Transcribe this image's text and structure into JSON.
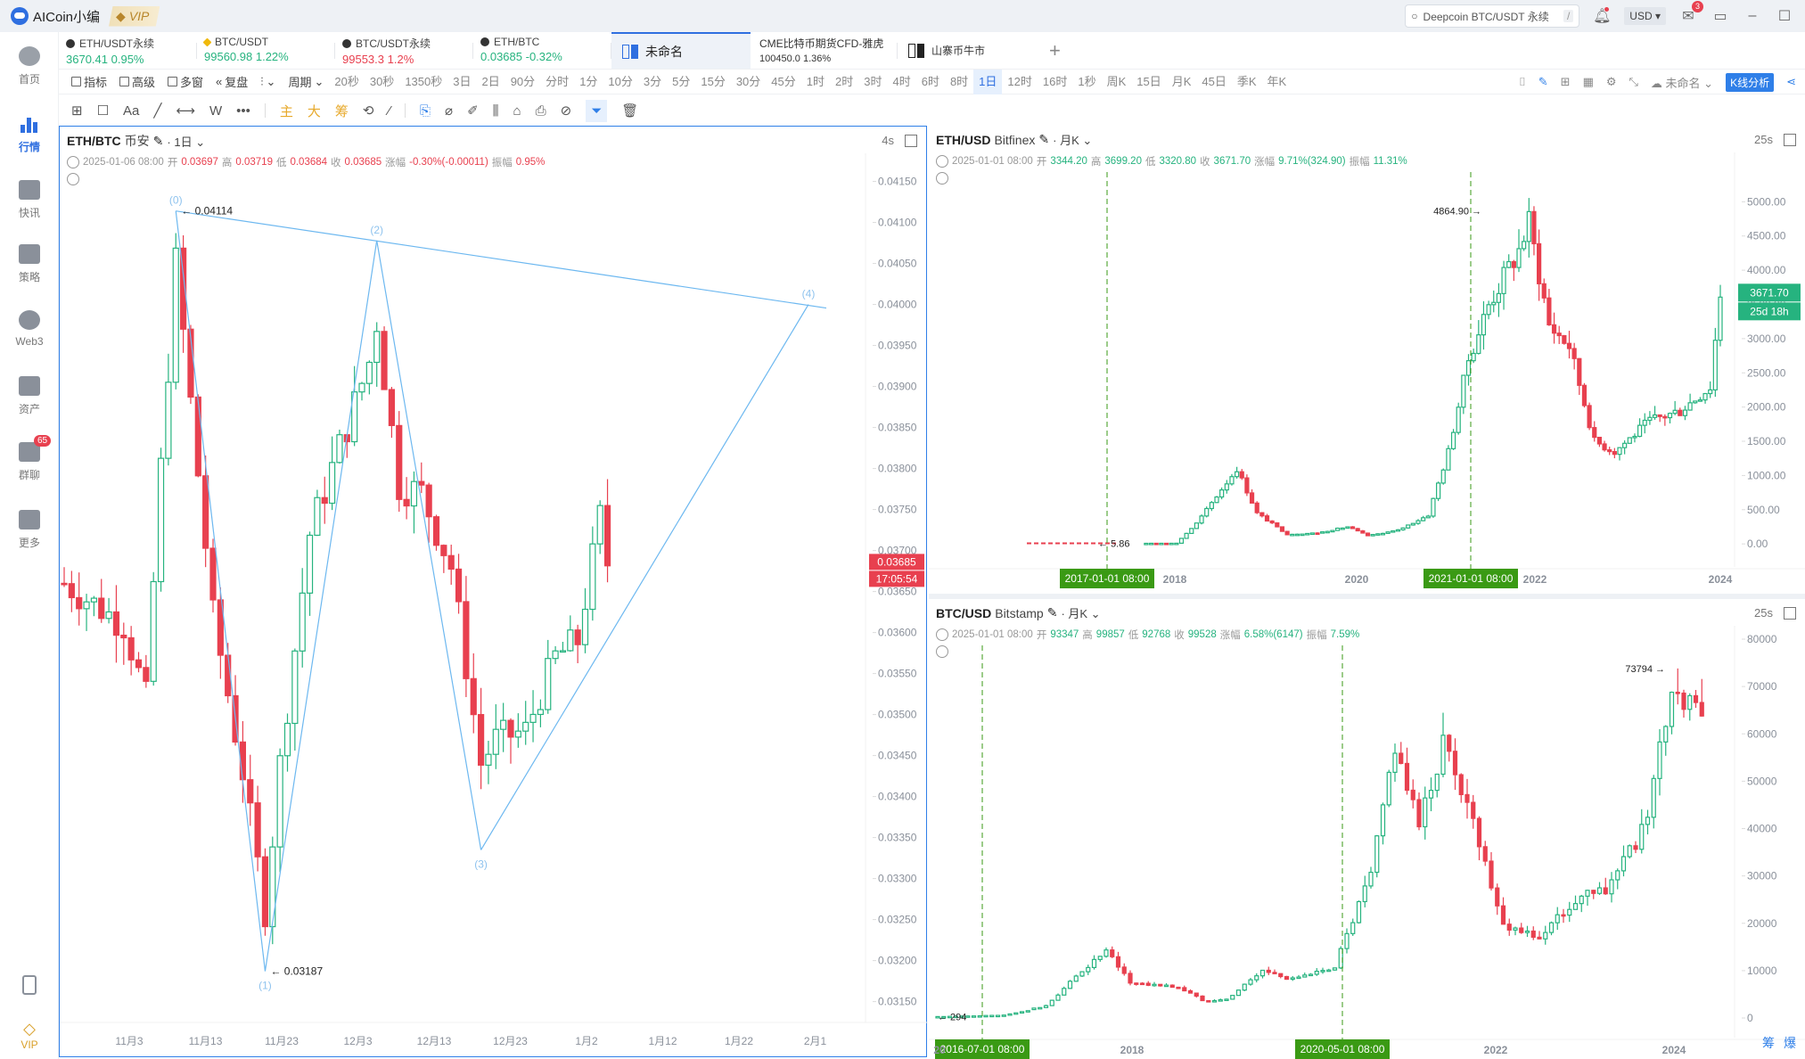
{
  "app": {
    "user": "AICoin小编",
    "vip_label": "VIP"
  },
  "titlebar": {
    "search_placeholder": "Deepcoin BTC/USDT 永续",
    "search_shortcut": "/",
    "currency": "USD",
    "mail_badge": "3"
  },
  "sidebar": {
    "items": [
      {
        "label": "首页",
        "icon": "home-icon"
      },
      {
        "label": "行情",
        "icon": "market-chart-icon",
        "active": true
      },
      {
        "label": "快讯",
        "icon": "news-icon"
      },
      {
        "label": "策略",
        "icon": "robot-icon"
      },
      {
        "label": "Web3",
        "icon": "web3-icon"
      },
      {
        "label": "资产",
        "icon": "wallet-icon"
      },
      {
        "label": "群聊",
        "icon": "chat-icon",
        "badge": "65"
      },
      {
        "label": "更多",
        "icon": "more-grid-icon"
      }
    ],
    "bottom": [
      {
        "icon": "mobile-icon"
      },
      {
        "label": "VIP",
        "icon": "vip-diamond-icon"
      }
    ]
  },
  "tickers": [
    {
      "name": "ETH/USDT永续",
      "value": "3670.41",
      "change": "0.95%",
      "dir": "up"
    },
    {
      "name": "BTC/USDT",
      "value": "99560.98",
      "change": "1.22%",
      "dir": "up"
    },
    {
      "name": "BTC/USDT永续",
      "value": "99553.3",
      "change": "1.2%",
      "dir": "dn"
    },
    {
      "name": "ETH/BTC",
      "value": "0.03685",
      "change": "-0.32%",
      "dir": "up"
    }
  ],
  "workspace_tabs": [
    {
      "label": "未命名",
      "active": true
    },
    {
      "label": "CME比特币期货CFD-雅虎",
      "value": "100450.0",
      "change": "1.36%"
    },
    {
      "label": "山寨币牛市"
    }
  ],
  "toolbar": {
    "tools": [
      "指标",
      "高级",
      "多窗",
      "复盘",
      "周期"
    ],
    "periods": [
      "20秒",
      "30秒",
      "1350秒",
      "3日",
      "2日",
      "90分",
      "分时",
      "1分",
      "10分",
      "3分",
      "5分",
      "15分",
      "30分",
      "45分",
      "1时",
      "2时",
      "3时",
      "4时",
      "6时",
      "8时",
      "1日",
      "12时",
      "16时",
      "1秒",
      "周K",
      "15日",
      "月K",
      "45日",
      "季K",
      "年K"
    ],
    "selected_period": "1日",
    "layout_name": "未命名",
    "kline_analysis": "K线分析"
  },
  "drawbar": {
    "text_tool": "Aa",
    "wave_tool": "W",
    "more": "•••",
    "gold": [
      "主",
      "大",
      "筹"
    ]
  },
  "charts": {
    "left": {
      "symbol": "ETH/BTC",
      "exchange": "币安",
      "timeframe": "1日",
      "refresh": "4s",
      "ohlc": {
        "date": "2025-01-06 08:00",
        "open_label": "开",
        "open": "0.03697",
        "high_label": "高",
        "high": "0.03719",
        "low_label": "低",
        "low": "0.03684",
        "close_label": "收",
        "close": "0.03685",
        "chg_label": "涨幅",
        "chg": "-0.30%(-0.00011)",
        "amp_label": "振幅",
        "amp": "0.95%"
      },
      "price_ticks": [
        "0.04150",
        "0.04100",
        "0.04050",
        "0.04000",
        "0.03950",
        "0.03900",
        "0.03850",
        "0.03800",
        "0.03750",
        "0.03700",
        "0.03650",
        "0.03600",
        "0.03550",
        "0.03500",
        "0.03450",
        "0.03400",
        "0.03350",
        "0.03300",
        "0.03250",
        "0.03200",
        "0.03150"
      ],
      "price_range": [
        0.0313,
        0.04168
      ],
      "date_ticks": [
        "11月3",
        "11月13",
        "11月23",
        "12月3",
        "12月13",
        "12月23",
        "1月2",
        "1月12",
        "1月22",
        "2月1"
      ],
      "last_price": "0.03685",
      "countdown": "17:05:54",
      "high_marker": "0.04114",
      "low_marker": "0.03187",
      "waves": [
        {
          "label": "(0)",
          "i": 15,
          "p": 0.04114
        },
        {
          "label": "(1)",
          "i": 27,
          "p": 0.03187
        },
        {
          "label": "(2)",
          "i": 42,
          "p": 0.04078
        },
        {
          "label": "(3)",
          "i": 56,
          "p": 0.03335
        },
        {
          "label": "(4)",
          "i": 100,
          "p": 0.04
        }
      ]
    },
    "eth_usd": {
      "symbol": "ETH/USD",
      "exchange": "Bitfinex",
      "timeframe": "月K",
      "refresh": "25s",
      "ohlc": {
        "date": "2025-01-01 08:00",
        "open_label": "开",
        "open": "3344.20",
        "high_label": "高",
        "high": "3699.20",
        "low_label": "低",
        "low": "3320.80",
        "close_label": "收",
        "close": "3671.70",
        "chg_label": "涨幅",
        "chg": "9.71%(324.90)",
        "amp_label": "振幅",
        "amp": "11.31%"
      },
      "price_ticks": [
        "5000.00",
        "4500.00",
        "4000.00",
        "3500.00",
        "3000.00",
        "2500.00",
        "2000.00",
        "1500.00",
        "1000.00",
        "500.00",
        "0.00"
      ],
      "year_ticks": [
        "2018",
        "2020",
        "2022",
        "2024"
      ],
      "last_price": "3671.70",
      "countdown": "25d 18h",
      "high_marker": "4864.90",
      "low_marker": "5.86",
      "crosshair_dates": [
        "2017-01-01 08:00",
        "2021-01-01 08:00"
      ]
    },
    "btc_usd": {
      "symbol": "BTC/USD",
      "exchange": "Bitstamp",
      "timeframe": "月K",
      "refresh": "25s",
      "ohlc": {
        "date": "2025-01-01 08:00",
        "open_label": "开",
        "open": "93347",
        "high_label": "高",
        "high": "99857",
        "low_label": "低",
        "low": "92768",
        "close_label": "收",
        "close": "99528",
        "chg_label": "涨幅",
        "chg": "6.58%(6147)",
        "amp_label": "振幅",
        "amp": "7.59%"
      },
      "price_ticks": [
        "80000",
        "70000",
        "60000",
        "50000",
        "40000",
        "30000",
        "20000",
        "10000",
        "0"
      ],
      "year_ticks": [
        "20",
        "2018",
        "2022",
        "2024"
      ],
      "high_marker": "73794",
      "low_marker": "294",
      "crosshair_dates": [
        "2016-07-01 08:00",
        "2020-05-01 08:00"
      ],
      "footer": [
        "筹",
        "爆"
      ]
    }
  },
  "colors": {
    "up": "#26b37f",
    "down": "#e8404f",
    "accent": "#2f7fe8",
    "wave": "#6db8f0",
    "crosshair": "#3a9a14"
  }
}
